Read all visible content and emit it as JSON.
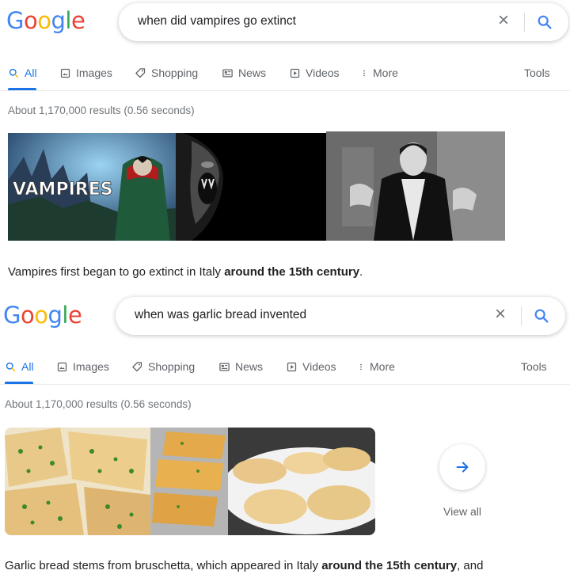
{
  "colors": {
    "accent": "#1a73e8",
    "google_blue": "#4285f4",
    "google_red": "#ea4335",
    "google_yellow": "#fbbc05",
    "google_green": "#34a853"
  },
  "searches": [
    {
      "logo": [
        "G",
        "o",
        "o",
        "g",
        "l",
        "e"
      ],
      "query": "when did vampires go extinct",
      "tabs": [
        {
          "label": "All",
          "icon": "search-icon"
        },
        {
          "label": "Images",
          "icon": "image-icon"
        },
        {
          "label": "Shopping",
          "icon": "tag-icon"
        },
        {
          "label": "News",
          "icon": "news-icon"
        },
        {
          "label": "Videos",
          "icon": "play-icon"
        },
        {
          "label": "More",
          "icon": "more-vert-icon"
        }
      ],
      "tools": "Tools",
      "stats": "About 1,170,000 results (0.56 seconds)",
      "image_caption_text": "VAMPIRES",
      "answer_pre": "Vampires first began to go extinct in Italy ",
      "answer_bold": "around the 15th century",
      "answer_post": "."
    },
    {
      "logo": [
        "G",
        "o",
        "o",
        "g",
        "l",
        "e"
      ],
      "query": "when was garlic bread invented",
      "tabs": [
        {
          "label": "All",
          "icon": "search-icon"
        },
        {
          "label": "Images",
          "icon": "image-icon"
        },
        {
          "label": "Shopping",
          "icon": "tag-icon"
        },
        {
          "label": "News",
          "icon": "news-icon"
        },
        {
          "label": "Videos",
          "icon": "play-icon"
        },
        {
          "label": "More",
          "icon": "more-vert-icon"
        }
      ],
      "tools": "Tools",
      "stats": "About 1,170,000 results (0.56 seconds)",
      "view_all": "View all",
      "answer_pre": "Garlic bread stems from bruschetta, which appeared in Italy ",
      "answer_bold": "around the 15th century",
      "answer_post": ", and"
    }
  ]
}
